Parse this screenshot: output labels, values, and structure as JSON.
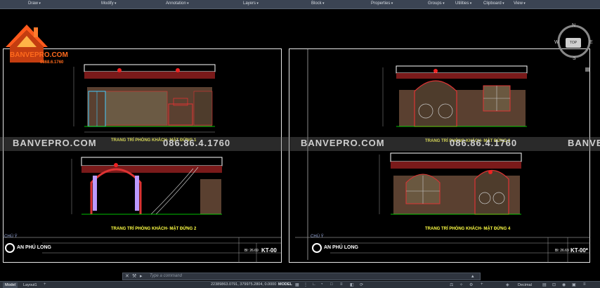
{
  "ribbon": {
    "panels": [
      "Draw",
      "Modify",
      "Annotation",
      "Layers",
      "Block",
      "Properties",
      "Groups",
      "Utilities",
      "Clipboard",
      "View"
    ]
  },
  "brand": {
    "name": "BANVEPRO.COM",
    "phone_small": "0868.6.1760"
  },
  "watermark": {
    "text1": "BANVEPRO.COM",
    "phone": "086.86.4.1760",
    "text2": "BANVEPRO.COM",
    "phone2": "086.86.4.1760",
    "text3": "BANVE"
  },
  "viewcube": {
    "n": "N",
    "s": "S",
    "w": "W",
    "e": "E",
    "top": "TOP"
  },
  "sheets": [
    {
      "title_upper": "TRANG TRÍ PHÒNG KHÁCH- MẶT ĐỨNG 1",
      "title_lower": "TRANG TRÍ PHÒNG KHÁCH- MẶT ĐỨNG 2",
      "chu_y": "CHÚ Ý",
      "company": "AN PHÚ LONG",
      "scale": "Bl: 26.69",
      "code": "KT-00"
    },
    {
      "title_upper": "TRANG TRÍ PHÒNG KHÁCH- MẶT ĐỨNG 3",
      "title_lower": "TRANG TRÍ PHÒNG KHÁCH- MẶT ĐỨNG 4",
      "chu_y": "CHÚ Ý",
      "company": "AN PHÚ LONG",
      "scale": "Bl: 26.69",
      "code": "KT-00*"
    }
  ],
  "command": {
    "placeholder": "Type a command"
  },
  "status": {
    "tabs": [
      "Model",
      "Layout1"
    ],
    "coords": "22389863.0791, 379975.2804, 0.0000",
    "model_label": "MODEL",
    "units": "Decimal"
  }
}
